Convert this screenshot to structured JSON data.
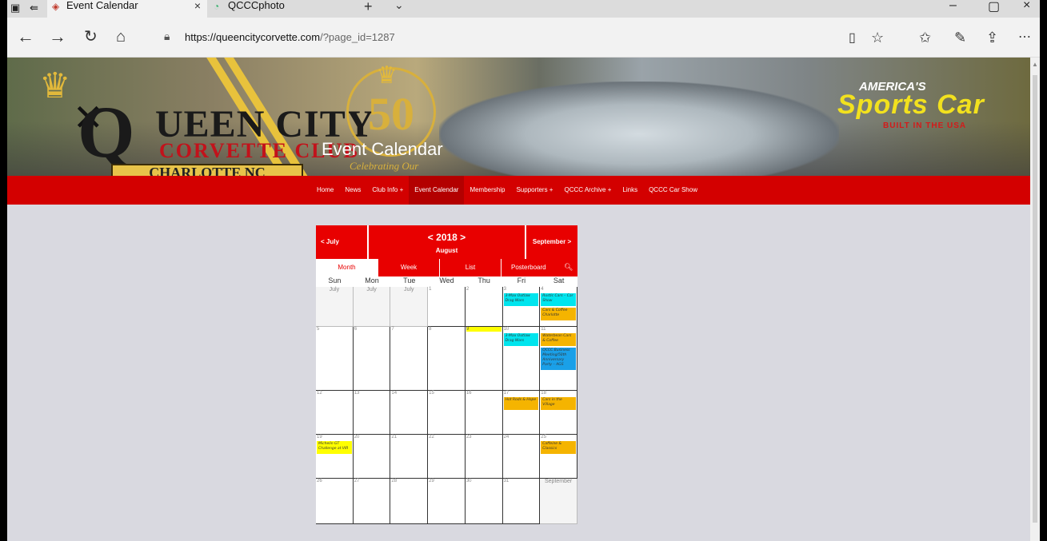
{
  "browser": {
    "tabs": [
      {
        "title": "Event Calendar",
        "active": true
      },
      {
        "title": "QCCCphoto",
        "active": false
      }
    ],
    "url_host": "https://queencitycorvette.com",
    "url_path": "/?page_id=1287"
  },
  "hero": {
    "logo_line1": "UEEN CITY",
    "logo_q": "Q",
    "logo_line2": "CORVETTE CLUB",
    "logo_line3": "CHARLOTTE NC",
    "emblem_number": "50",
    "emblem_script": "Celebrating Our",
    "page_title": "Event Calendar",
    "badge_line1": "AMERICA'S",
    "badge_line2": "Sports Car",
    "badge_line3": "BUILT IN THE USA"
  },
  "nav": {
    "items": [
      "Home",
      "News",
      "Club Info +",
      "Event Calendar",
      "Membership",
      "Supporters +",
      "QCCC Archive +",
      "Links",
      "QCCC Car Show"
    ],
    "current": "Event Calendar"
  },
  "calendar": {
    "prev": "< July",
    "year": "< 2018 >",
    "month": "August",
    "next": "September >",
    "views": [
      "Month",
      "Week",
      "List",
      "Posterboard"
    ],
    "active_view": "Month",
    "weekdays": [
      "Sun",
      "Mon",
      "Tue",
      "Wed",
      "Thu",
      "Fri",
      "Sat"
    ],
    "weeks": [
      [
        {
          "label": "July",
          "off": true
        },
        {
          "label": "July",
          "off": true
        },
        {
          "label": "July",
          "off": true
        },
        {
          "label": "1"
        },
        {
          "label": "2"
        },
        {
          "label": "3",
          "events": [
            {
              "title": "3-Max Outlaw Drag Wars",
              "color": "#00e5ee"
            }
          ]
        },
        {
          "label": "4",
          "events": [
            {
              "title": "Rustic Cars – Car Show",
              "color": "#00e5ee"
            },
            {
              "title": "Cars & Coffee Charlotte",
              "color": "#f5b400"
            }
          ]
        }
      ],
      [
        {
          "label": "5"
        },
        {
          "label": "6"
        },
        {
          "label": "7"
        },
        {
          "label": "8"
        },
        {
          "label": "9",
          "today": true
        },
        {
          "label": "10",
          "events": [
            {
              "title": "3-Max Outlaw Drag Wars",
              "color": "#00e5ee"
            }
          ]
        },
        {
          "label": "11",
          "events": [
            {
              "title": "Waterbean Cars & Coffee",
              "color": "#f5b400"
            },
            {
              "title": "QCCC Business Meeting/50th Anniversary Party – AGS",
              "color": "#1aa0e8"
            }
          ]
        }
      ],
      [
        {
          "label": "12"
        },
        {
          "label": "13"
        },
        {
          "label": "14"
        },
        {
          "label": "15"
        },
        {
          "label": "16"
        },
        {
          "label": "17",
          "events": [
            {
              "title": "Hot Rods & Hope",
              "color": "#f5b400"
            }
          ]
        },
        {
          "label": "18",
          "events": [
            {
              "title": "Cars in the Village",
              "color": "#f5b400"
            }
          ]
        }
      ],
      [
        {
          "label": "19",
          "events": [
            {
              "title": "Michelin GT Challenge at VIR",
              "color": "#ffff00"
            }
          ]
        },
        {
          "label": "20"
        },
        {
          "label": "21"
        },
        {
          "label": "22"
        },
        {
          "label": "23"
        },
        {
          "label": "24"
        },
        {
          "label": "25",
          "events": [
            {
              "title": "Caffeine & Classics",
              "color": "#f5b400"
            }
          ]
        }
      ],
      [
        {
          "label": "26"
        },
        {
          "label": "27"
        },
        {
          "label": "28"
        },
        {
          "label": "29"
        },
        {
          "label": "30"
        },
        {
          "label": "31"
        },
        {
          "label": "September",
          "off": true
        }
      ]
    ]
  }
}
